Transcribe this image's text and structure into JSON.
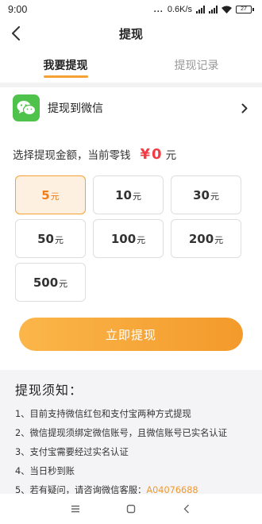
{
  "status_bar": {
    "time": "9:00",
    "dots": "...",
    "network_speed": "0.6K/s",
    "battery": "27"
  },
  "nav": {
    "title": "提现"
  },
  "tabs": [
    {
      "label": "我要提现",
      "active": true
    },
    {
      "label": "提现记录",
      "active": false
    }
  ],
  "wechat_row": {
    "label": "提现到微信",
    "icon": "wechat-icon"
  },
  "amount": {
    "prompt": "选择提现金额，当前零钱",
    "currency_symbol": "¥",
    "balance": "0",
    "unit": "元"
  },
  "options": [
    {
      "value": "5",
      "unit": "元",
      "selected": true
    },
    {
      "value": "10",
      "unit": "元",
      "selected": false
    },
    {
      "value": "30",
      "unit": "元",
      "selected": false
    },
    {
      "value": "50",
      "unit": "元",
      "selected": false
    },
    {
      "value": "100",
      "unit": "元",
      "selected": false
    },
    {
      "value": "200",
      "unit": "元",
      "selected": false
    },
    {
      "value": "500",
      "unit": "元",
      "selected": false
    }
  ],
  "submit_label": "立即提现",
  "notice": {
    "title": "提现须知：",
    "lines": [
      "1、目前支持微信红包和支付宝两种方式提现",
      "2、微信提现须绑定微信账号，且微信账号已实名认证",
      "3、支付宝需要经过实名认证",
      "4、当日秒到账",
      "5、若有疑问，请咨询微信客服："
    ],
    "service_id": "A04076688"
  },
  "colors": {
    "accent": "#f5a134",
    "balance_red": "#f23b45",
    "wechat_green": "#4fc24b",
    "selected_bg": "#fdf0e1"
  }
}
